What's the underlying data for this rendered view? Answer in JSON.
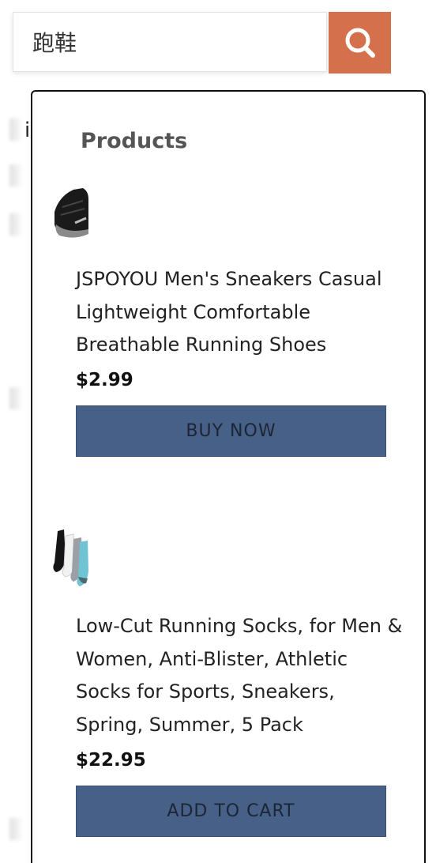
{
  "search": {
    "value": "跑鞋",
    "icon": "search-icon",
    "button_color": "#d5704c"
  },
  "background": {
    "partial_letter": "i"
  },
  "dropdown": {
    "section_title": "Products",
    "products": [
      {
        "name": "JSPOYOU Men's Sneakers Casual Lightweight Comfortable Breathable Running Shoes",
        "price": "$2.99",
        "button_label": "BUY NOW",
        "thumbnail": "sneaker-thumbnail"
      },
      {
        "name": "Low-Cut Running Socks, for Men & Women, Anti-Blister, Athletic Socks for Sports, Sneakers, Spring, Summer, 5 Pack",
        "price": "$22.95",
        "button_label": "ADD TO CART",
        "thumbnail": "socks-thumbnail"
      }
    ]
  },
  "colors": {
    "accent": "#d5704c",
    "button": "#466088"
  }
}
